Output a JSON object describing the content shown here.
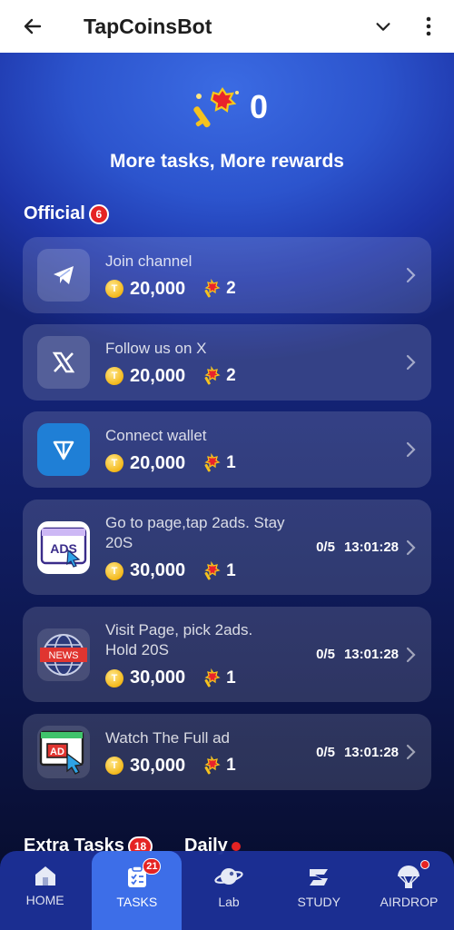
{
  "topbar": {
    "title": "TapCoinsBot",
    "back_icon": "arrow-left-icon",
    "dropdown_icon": "chevron-down-icon",
    "menu_icon": "kebab-menu-icon"
  },
  "hero": {
    "key_count": "0",
    "subtitle": "More tasks, More rewards"
  },
  "official": {
    "title": "Official",
    "badge": "6"
  },
  "tasks": [
    {
      "name": "Join channel",
      "coins": "20,000",
      "keys": "2",
      "icon": "telegram-icon",
      "progress": "",
      "timer": ""
    },
    {
      "name": "Follow us on X",
      "coins": "20,000",
      "keys": "2",
      "icon": "x-logo-icon",
      "progress": "",
      "timer": ""
    },
    {
      "name": "Connect wallet",
      "coins": "20,000",
      "keys": "1",
      "icon": "ton-wallet-icon",
      "progress": "",
      "timer": ""
    },
    {
      "name": "Go to page,tap 2ads. Stay 20S",
      "coins": "30,000",
      "keys": "1",
      "icon": "ads-icon",
      "progress": "0/5",
      "timer": "13:01:28"
    },
    {
      "name": "Visit Page, pick 2ads. Hold 20S",
      "coins": "30,000",
      "keys": "1",
      "icon": "news-globe-icon",
      "progress": "0/5",
      "timer": "13:01:28"
    },
    {
      "name": "Watch The Full ad",
      "coins": "30,000",
      "keys": "1",
      "icon": "ad-screen-icon",
      "progress": "0/5",
      "timer": "13:01:28"
    }
  ],
  "extra": {
    "title": "Extra Tasks",
    "badge": "18",
    "daily": "Daily"
  },
  "nav": [
    {
      "label": "HOME",
      "icon": "home-icon"
    },
    {
      "label": "TASKS",
      "icon": "tasks-icon",
      "badge": "21"
    },
    {
      "label": "Lab",
      "icon": "lab-planet-icon"
    },
    {
      "label": "STUDY",
      "icon": "study-icon"
    },
    {
      "label": "AIRDROP",
      "icon": "airdrop-icon"
    }
  ],
  "colors": {
    "accent": "#3d6ee8",
    "badge": "#e52323",
    "coin": "#f3b81a"
  }
}
